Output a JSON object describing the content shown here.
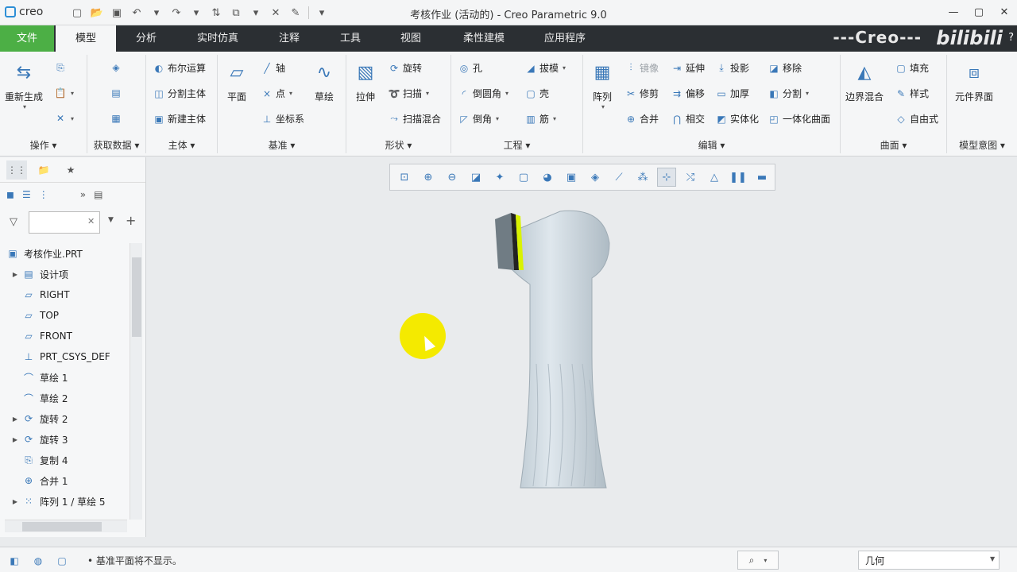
{
  "app": {
    "logo_text": "creo",
    "window_title": "考核作业 (活动的) - Creo Parametric 9.0",
    "brand_watermark": "---Creo---",
    "bilibili_watermark": "bilibili",
    "help_glyph": "?"
  },
  "tabs": [
    {
      "label": "文件"
    },
    {
      "label": "模型"
    },
    {
      "label": "分析"
    },
    {
      "label": "实时仿真"
    },
    {
      "label": "注释"
    },
    {
      "label": "工具"
    },
    {
      "label": "视图"
    },
    {
      "label": "柔性建模"
    },
    {
      "label": "应用程序"
    }
  ],
  "ribbon": {
    "operations": {
      "label": "操作",
      "regenerate": "重新生成"
    },
    "get_data": {
      "label": "获取数据"
    },
    "body": {
      "label": "主体",
      "boolean": "布尔运算",
      "split_body": "分割主体",
      "new_body": "新建主体"
    },
    "datum": {
      "label": "基准",
      "plane": "平面",
      "axis": "轴",
      "point": "点",
      "csys": "坐标系",
      "sketch": "草绘"
    },
    "shapes": {
      "label": "形状",
      "extrude": "拉伸",
      "revolve": "旋转",
      "sweep": "扫描",
      "swept_blend": "扫描混合"
    },
    "engineering": {
      "label": "工程",
      "hole": "孔",
      "round": "倒圆角",
      "chamfer": "倒角",
      "draft": "拔模",
      "shell": "壳",
      "rib": "筋"
    },
    "editing": {
      "label": "编辑",
      "pattern": "阵列",
      "mirror": "镜像",
      "extend": "延伸",
      "project": "投影",
      "remove": "移除",
      "trim": "修剪",
      "offset": "偏移",
      "thicken": "加厚",
      "split": "分割",
      "merge": "合并",
      "intersect": "相交",
      "solidify": "实体化",
      "unify_surface": "一体化曲面"
    },
    "surfaces": {
      "label": "曲面",
      "boundary_blend": "边界混合",
      "fill": "填充",
      "style": "样式",
      "freestyle": "自由式"
    },
    "model_intent": {
      "label": "模型意图",
      "component_interface": "元件界面"
    }
  },
  "filter": {
    "value": "",
    "placeholder": ""
  },
  "tree": [
    {
      "label": "考核作业.PRT",
      "icon": "part-icon",
      "expandable": false,
      "root": true
    },
    {
      "label": "设计项",
      "icon": "design-items-icon",
      "expandable": true
    },
    {
      "label": "RIGHT",
      "icon": "datum-plane-icon",
      "expandable": false
    },
    {
      "label": "TOP",
      "icon": "datum-plane-icon",
      "expandable": false
    },
    {
      "label": "FRONT",
      "icon": "datum-plane-icon",
      "expandable": false
    },
    {
      "label": "PRT_CSYS_DEF",
      "icon": "csys-icon",
      "expandable": false
    },
    {
      "label": "草绘 1",
      "icon": "sketch-icon",
      "expandable": false
    },
    {
      "label": "草绘 2",
      "icon": "sketch-icon",
      "expandable": false
    },
    {
      "label": "旋转 2",
      "icon": "revolve-icon",
      "expandable": true
    },
    {
      "label": "旋转 3",
      "icon": "revolve-icon",
      "expandable": true
    },
    {
      "label": "复制 4",
      "icon": "copy-icon",
      "expandable": false
    },
    {
      "label": "合并 1",
      "icon": "merge-icon",
      "expandable": false
    },
    {
      "label": "阵列 1 / 草绘 5",
      "icon": "pattern-icon",
      "expandable": true
    }
  ],
  "status": {
    "message": "基准平面将不显示。",
    "selection_filter": "几何"
  },
  "colors": {
    "file_tab": "#4caf45",
    "tabbar_bg": "#2b2f33",
    "model_body": "#cdd8e0",
    "model_edge_highlight": "#d9f200",
    "cursor_highlight": "#f4ea00"
  }
}
